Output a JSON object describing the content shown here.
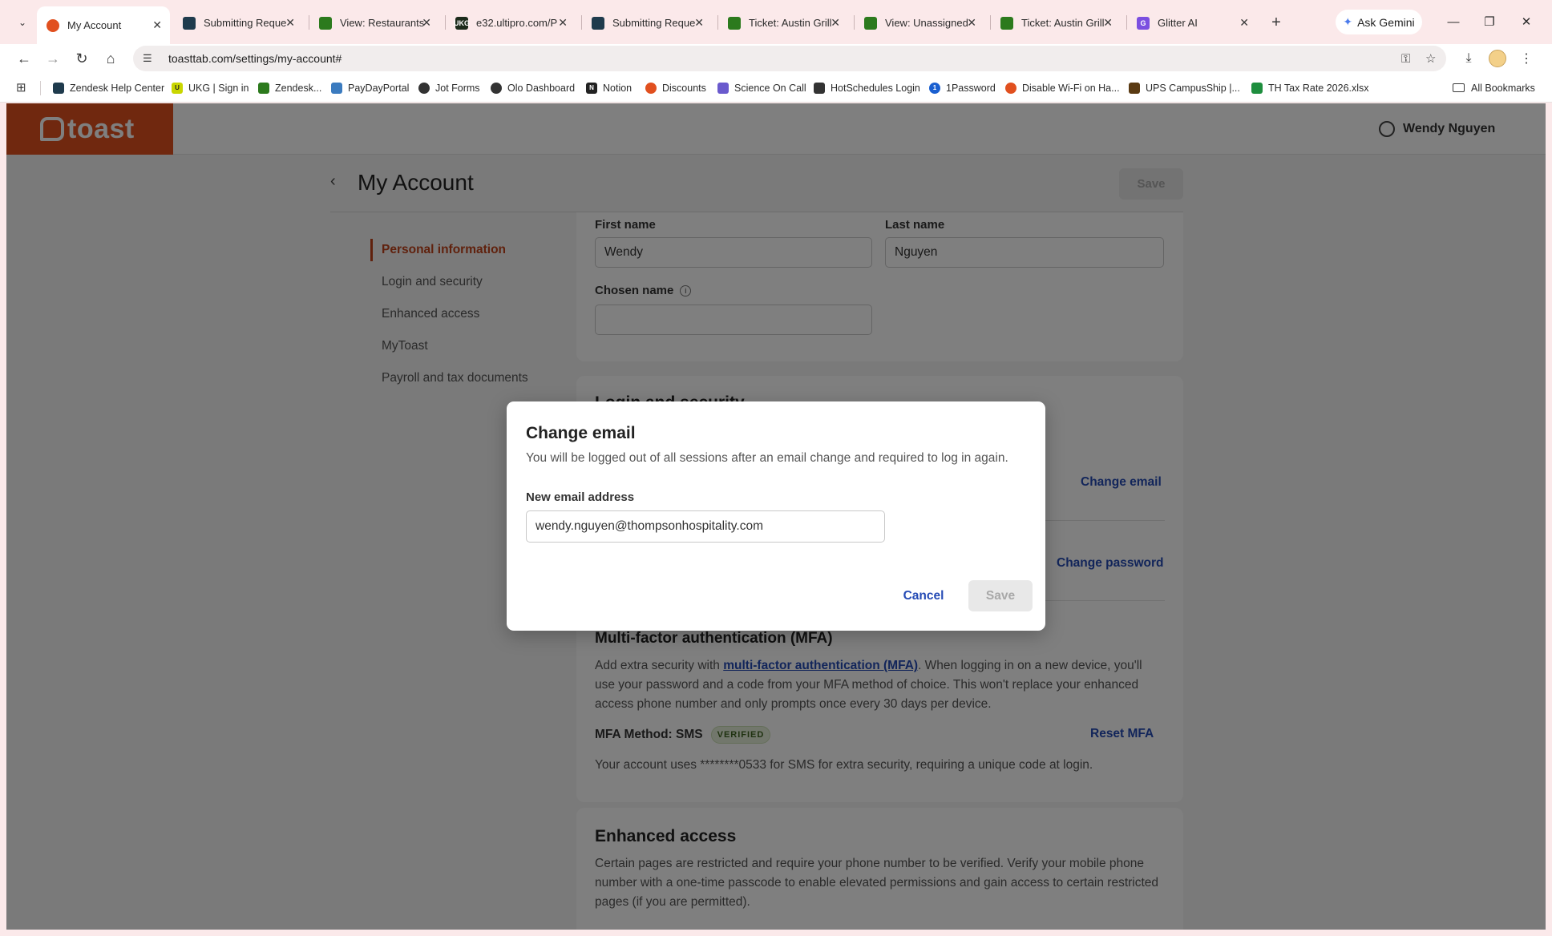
{
  "browser": {
    "tabs": [
      {
        "title": "My Account",
        "icon": "toast-icon",
        "color": "#e1501f",
        "active": true
      },
      {
        "title": "Submitting Reque",
        "icon": "zendesk-guide-icon",
        "color": "#1f3b4d",
        "active": false
      },
      {
        "title": "View: Restaurants",
        "icon": "zendesk-icon",
        "color": "#2c7a1d",
        "active": false
      },
      {
        "title": "e32.ultipro.com/P",
        "icon": "ukg-icon",
        "color": "#1b2b1b",
        "active": false
      },
      {
        "title": "Submitting Reque",
        "icon": "zendesk-guide-icon",
        "color": "#1f3b4d",
        "active": false
      },
      {
        "title": "Ticket: Austin Grill",
        "icon": "zendesk-icon",
        "color": "#2c7a1d",
        "active": false
      },
      {
        "title": "View: Unassigned",
        "icon": "zendesk-icon",
        "color": "#2c7a1d",
        "active": false
      },
      {
        "title": "Ticket: Austin Grill",
        "icon": "zendesk-icon",
        "color": "#2c7a1d",
        "active": false
      },
      {
        "title": "Glitter AI",
        "icon": "glitter-icon",
        "color": "#7b4fe0",
        "active": false
      }
    ],
    "new_tab": "+",
    "gemini_label": "Ask Gemini",
    "url": "toasttab.com/settings/my-account#",
    "bookmarks": [
      {
        "label": "Zendesk Help Center",
        "icon": "zendesk-guide-icon",
        "color": "#1f3b4d"
      },
      {
        "label": "UKG | Sign in",
        "icon": "ukg-icon",
        "color": "#c9d600"
      },
      {
        "label": "Zendesk...",
        "icon": "zendesk-icon",
        "color": "#2c7a1d"
      },
      {
        "label": "PayDayPortal",
        "icon": "payday-icon",
        "color": "#3b7bbf"
      },
      {
        "label": "Jot Forms",
        "icon": "jotform-icon",
        "color": "#333333"
      },
      {
        "label": "Olo Dashboard",
        "icon": "olo-icon",
        "color": "#333333"
      },
      {
        "label": "Notion",
        "icon": "notion-icon",
        "color": "#222222"
      },
      {
        "label": "Discounts",
        "icon": "toast-icon",
        "color": "#e1501f"
      },
      {
        "label": "Science On Call",
        "icon": "science-icon",
        "color": "#6a5acd"
      },
      {
        "label": "HotSchedules Login",
        "icon": "hotschedules-icon",
        "color": "#333333"
      },
      {
        "label": "1Password",
        "icon": "onepassword-icon",
        "color": "#1a5fd0"
      },
      {
        "label": "Disable Wi-Fi on Ha...",
        "icon": "toast-icon",
        "color": "#e1501f"
      },
      {
        "label": "UPS CampusShip |...",
        "icon": "ups-icon",
        "color": "#5a3a12"
      },
      {
        "label": "TH Tax Rate 2026.xlsx",
        "icon": "sheets-icon",
        "color": "#1e8e3e"
      }
    ],
    "all_bookmarks": "All Bookmarks"
  },
  "app": {
    "logo_text": "toast",
    "user_name": "Wendy Nguyen",
    "page_title": "My Account",
    "save_label": "Save",
    "sidebar": [
      {
        "label": "Personal information",
        "active": true
      },
      {
        "label": "Login and security",
        "active": false
      },
      {
        "label": "Enhanced access",
        "active": false
      },
      {
        "label": "MyToast",
        "active": false
      },
      {
        "label": "Payroll and tax documents",
        "active": false
      }
    ],
    "personal": {
      "first_name_label": "First name",
      "first_name_value": "Wendy",
      "last_name_label": "Last name",
      "last_name_value": "Nguyen",
      "chosen_name_label": "Chosen name",
      "chosen_name_value": ""
    },
    "security": {
      "title": "Login and security",
      "change_email": "Change email",
      "change_password": "Change password",
      "mfa_title": "Multi-factor authentication (MFA)",
      "mfa_desc_prefix": "Add extra security with ",
      "mfa_link": "multi-factor authentication (MFA)",
      "mfa_desc_suffix": ". When logging in on a new device, you'll use your password and a code from your MFA method of choice. This won't replace your enhanced access phone number and only prompts once every 30 days per device.",
      "mfa_method": "MFA Method: SMS",
      "mfa_badge": "VERIFIED",
      "reset_mfa": "Reset MFA",
      "mfa_note": "Your account uses ********0533 for SMS for extra security, requiring a unique code at login."
    },
    "enhanced": {
      "title": "Enhanced access",
      "desc": "Certain pages are restricted and require your phone number to be verified. Verify your mobile phone number with a one-time passcode to enable elevated permissions and gain access to certain restricted pages (if you are permitted)."
    }
  },
  "modal": {
    "title": "Change email",
    "description": "You will be logged out of all sessions after an email change and required to log in again.",
    "field_label": "New email address",
    "field_value": "wendy.nguyen@thompsonhospitality.com",
    "cancel_label": "Cancel",
    "save_label": "Save"
  }
}
